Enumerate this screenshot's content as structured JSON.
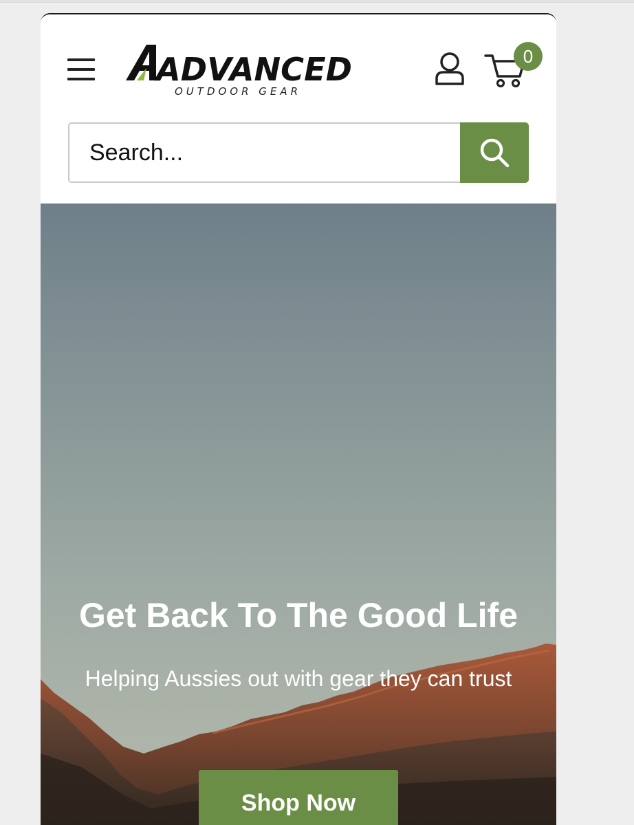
{
  "header": {
    "logo_text": "ADVANCED",
    "logo_subtitle": "OUTDOOR GEAR",
    "cart_count": "0"
  },
  "search": {
    "placeholder": "Search..."
  },
  "hero": {
    "title": "Get Back To The Good Life",
    "subtitle": "Helping Aussies out with gear they can trust",
    "cta_label": "Shop Now"
  },
  "colors": {
    "accent": "#6a8e45",
    "text_dark": "#222222",
    "hero_text": "#ffffff"
  },
  "icons": [
    "hamburger-menu-icon",
    "account-icon",
    "cart-icon",
    "search-icon"
  ]
}
